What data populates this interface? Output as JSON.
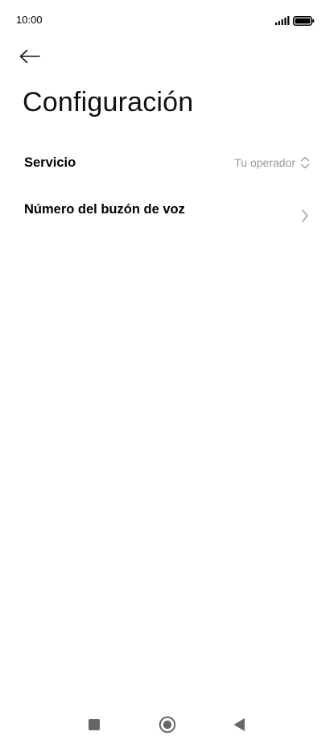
{
  "status_bar": {
    "time": "10:00",
    "signal_icon": "signal-icon",
    "battery_icon": "battery-icon"
  },
  "header": {
    "back_icon": "arrow-left-icon",
    "title": "Configuración"
  },
  "settings": {
    "service": {
      "label": "Servicio",
      "value": "Tu operador",
      "icon": "up-down-chevron-icon"
    },
    "voicemail": {
      "label": "Número del buzón de voz",
      "icon": "chevron-right-icon"
    }
  },
  "nav_bar": {
    "recents_icon": "square-icon",
    "home_icon": "circle-icon",
    "back_icon": "triangle-back-icon"
  },
  "colors": {
    "background": "#ffffff",
    "text": "#000000",
    "secondary_text": "#9a9a9a",
    "nav_icon": "#666666"
  }
}
